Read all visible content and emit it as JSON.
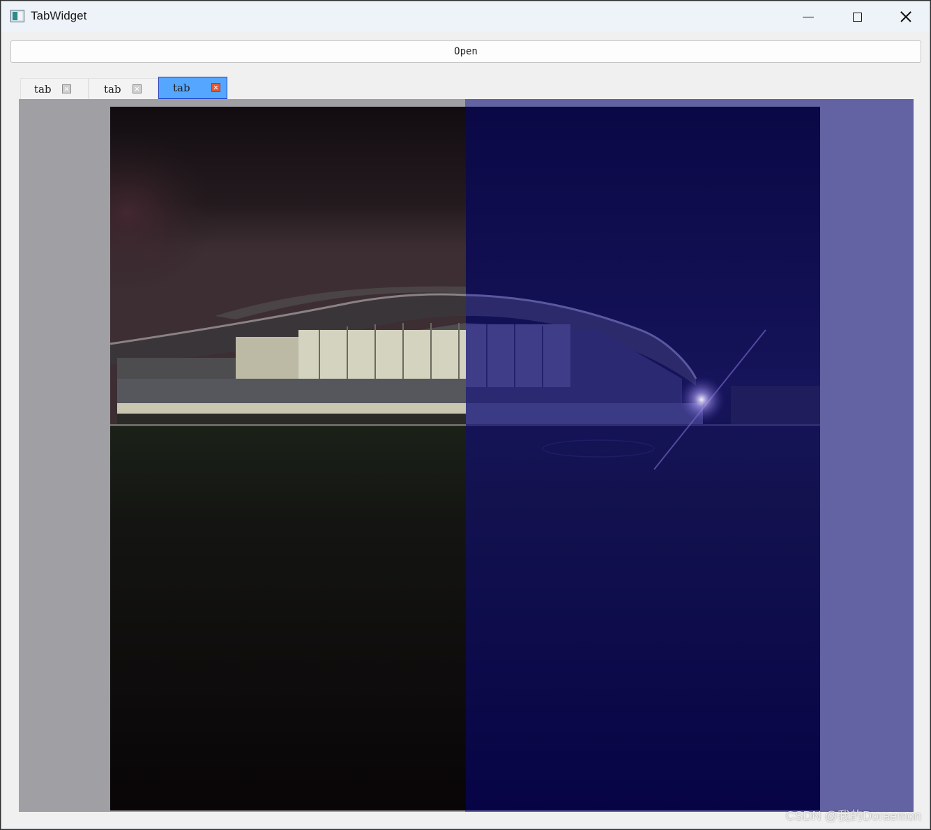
{
  "window": {
    "title": "TabWidget",
    "controls": {
      "minimize": "minimize-icon",
      "maximize": "maximize-icon",
      "close": "close-icon"
    }
  },
  "toolbar": {
    "open_label": "Open"
  },
  "tabs": [
    {
      "label": "tab",
      "active": false
    },
    {
      "label": "tab",
      "active": false
    },
    {
      "label": "tab",
      "active": true
    }
  ],
  "colors": {
    "active_tab": "#55a6ff",
    "active_tab_border": "#1f3fbf",
    "overlay_blue": "#6363a3",
    "pane_grey": "#a09fa4",
    "close_active": "#e8572f"
  },
  "watermark": "CSDN @我的Doraemon"
}
